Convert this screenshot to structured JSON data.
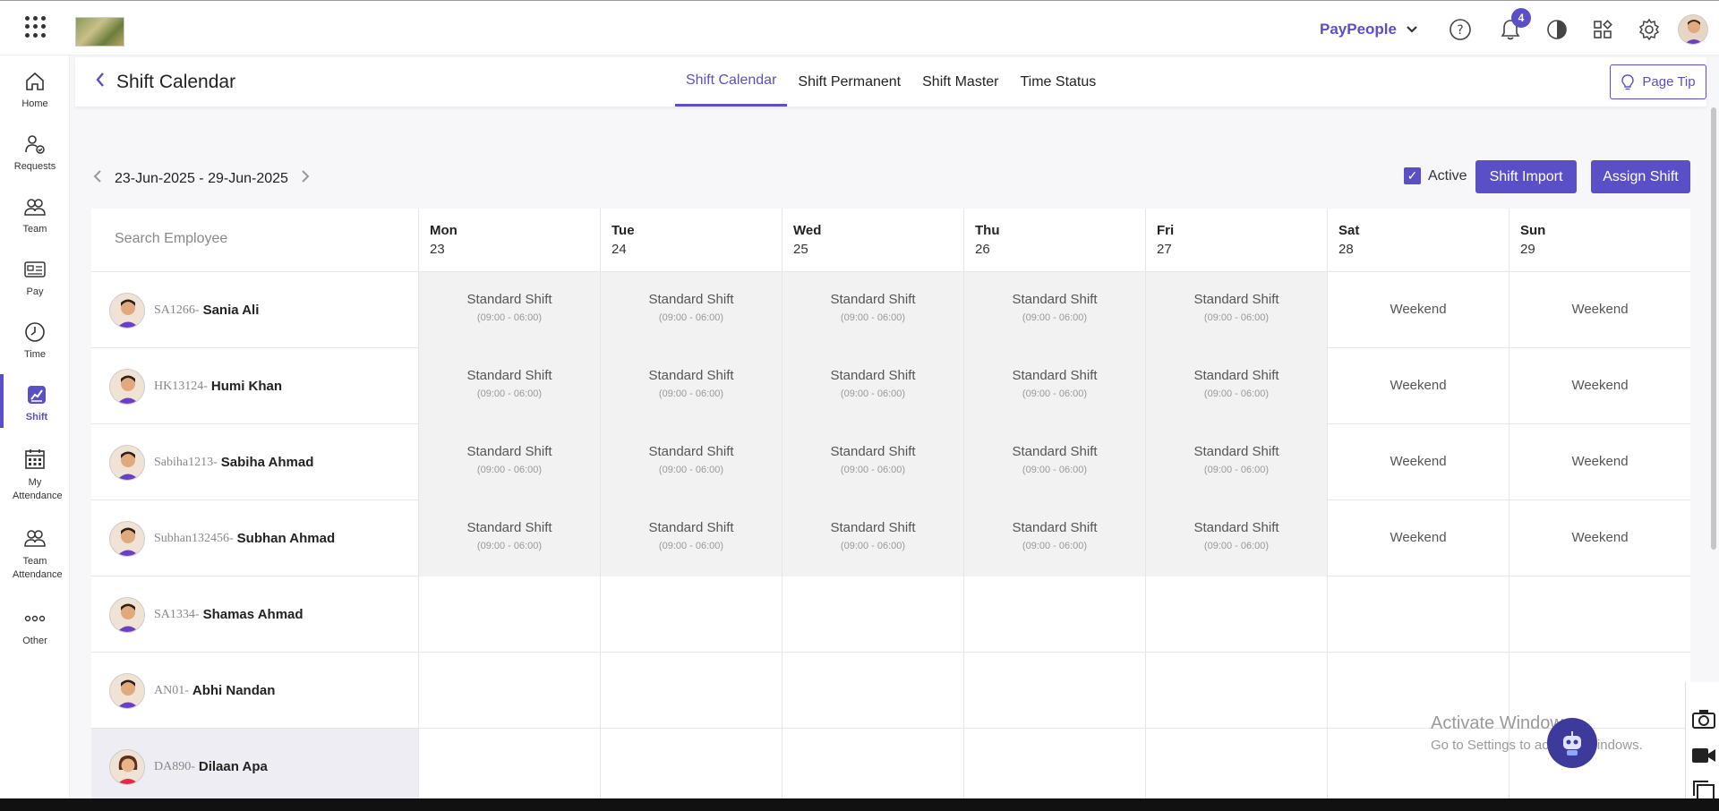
{
  "topbar": {
    "brand": "PayPeople",
    "notification_count": "4"
  },
  "sidebar": {
    "items": [
      {
        "label": "Home",
        "icon": "home-icon"
      },
      {
        "label": "Requests",
        "icon": "requests-icon"
      },
      {
        "label": "Team",
        "icon": "team-icon"
      },
      {
        "label": "Pay",
        "icon": "pay-icon"
      },
      {
        "label": "Time",
        "icon": "clock-icon"
      },
      {
        "label": "Shift",
        "icon": "shift-icon",
        "active": true
      },
      {
        "label": "My Attendance",
        "icon": "calendar-icon"
      },
      {
        "label": "Team Attendance",
        "icon": "team-attendance-icon"
      },
      {
        "label": "Other",
        "icon": "more-icon"
      }
    ]
  },
  "header": {
    "title": "Shift Calendar",
    "tabs": [
      {
        "label": "Shift Calendar",
        "active": true
      },
      {
        "label": "Shift Permanent"
      },
      {
        "label": "Shift Master"
      },
      {
        "label": "Time Status"
      }
    ],
    "page_tip": "Page Tip"
  },
  "toolbar": {
    "date_range": "23-Jun-2025 - 29-Jun-2025",
    "active_label": "Active",
    "active_checked": true,
    "shift_import": "Shift Import",
    "assign_shift": "Assign Shift"
  },
  "grid": {
    "search_placeholder": "Search Employee",
    "days": [
      {
        "name": "Mon",
        "date": "23"
      },
      {
        "name": "Tue",
        "date": "24"
      },
      {
        "name": "Wed",
        "date": "25"
      },
      {
        "name": "Thu",
        "date": "26"
      },
      {
        "name": "Fri",
        "date": "27"
      },
      {
        "name": "Sat",
        "date": "28"
      },
      {
        "name": "Sun",
        "date": "29"
      }
    ],
    "shift_name": "Standard Shift",
    "shift_time": "(09:00 - 06:00)",
    "weekend_label": "Weekend",
    "employees": [
      {
        "code": "SA1266-",
        "name": "Sania Ali",
        "has_shift": true
      },
      {
        "code": "HK13124-",
        "name": "Humi Khan",
        "has_shift": true
      },
      {
        "code": "Sabiha1213-",
        "name": "Sabiha Ahmad",
        "has_shift": true
      },
      {
        "code": "Subhan132456-",
        "name": "Subhan Ahmad",
        "has_shift": true
      },
      {
        "code": "SA1334-",
        "name": "Shamas Ahmad",
        "has_shift": false
      },
      {
        "code": "AN01-",
        "name": "Abhi Nandan",
        "has_shift": false
      },
      {
        "code": "DA890-",
        "name": "Dilaan Apa",
        "has_shift": false,
        "selected": true,
        "female": true
      }
    ]
  },
  "watermark": {
    "line1": "Activate Windows",
    "line2": "Go to Settings to activate Windows."
  },
  "colors": {
    "accent": "#5b4fc7"
  }
}
